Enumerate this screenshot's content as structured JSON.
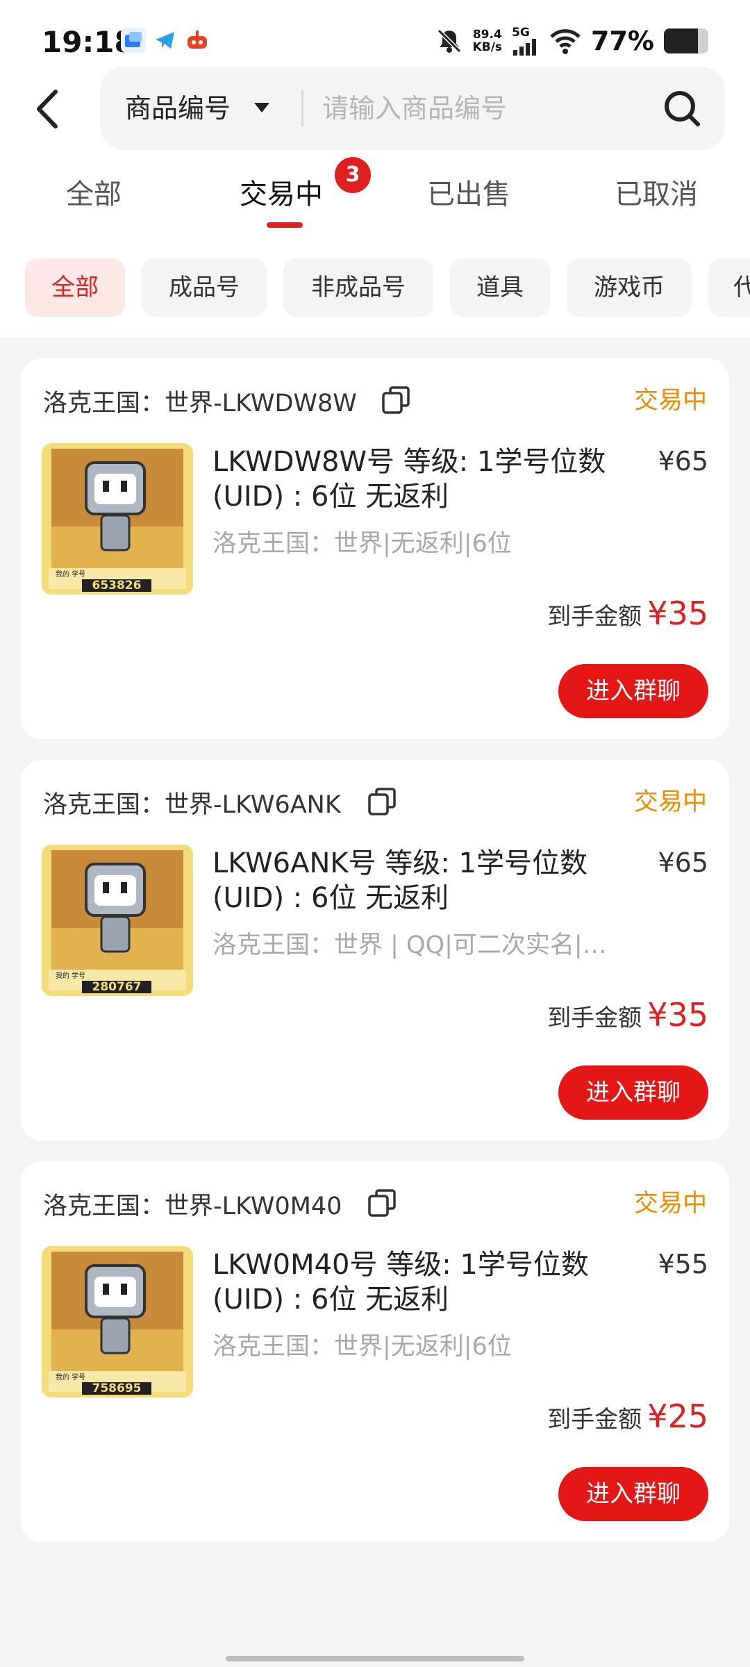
{
  "status_bar": {
    "time": "19:18",
    "net_speed_value": "89.4",
    "net_speed_unit": "KB/s",
    "network": "5G",
    "battery_percent": "77%",
    "battery_level": 0.77
  },
  "search": {
    "type_label": "商品编号",
    "placeholder": "请输入商品编号"
  },
  "tabs": [
    {
      "label": "全部"
    },
    {
      "label": "交易中",
      "badge": "3"
    },
    {
      "label": "已出售"
    },
    {
      "label": "已取消"
    }
  ],
  "chips": [
    {
      "label": "全部"
    },
    {
      "label": "成品号"
    },
    {
      "label": "非成品号"
    },
    {
      "label": "道具"
    },
    {
      "label": "游戏币"
    },
    {
      "label": "代"
    }
  ],
  "orders": [
    {
      "title": "洛克王国：世界-LKWDW8W",
      "status": "交易中",
      "name": "LKWDW8W号 等级: 1学号位数(UID) : 6位 无返利",
      "price": "¥65",
      "desc": "洛克王国：世界|无返利|6位",
      "net_label": "到手金额",
      "net_amount": "¥35",
      "button": "进入群聊",
      "thumb_number": "653826",
      "thumb_caption": "我的 学号"
    },
    {
      "title": "洛克王国：世界-LKW6ANK",
      "status": "交易中",
      "name": "LKW6ANK号 等级: 1学号位数(UID) : 6位 无返利",
      "price": "¥65",
      "desc": "洛克王国：世界 | QQ|可二次实名|…",
      "net_label": "到手金额",
      "net_amount": "¥35",
      "button": "进入群聊",
      "thumb_number": "280767",
      "thumb_caption": "我的 学号"
    },
    {
      "title": "洛克王国：世界-LKW0M40",
      "status": "交易中",
      "name": "LKW0M40号 等级: 1学号位数(UID) : 6位 无返利",
      "price": "¥55",
      "desc": "洛克王国：世界|无返利|6位",
      "net_label": "到手金额",
      "net_amount": "¥25",
      "button": "进入群聊",
      "thumb_number": "758695",
      "thumb_caption": "我的 学号"
    }
  ],
  "colors": {
    "accent_red": "#e02020",
    "status_orange": "#f08c00"
  }
}
